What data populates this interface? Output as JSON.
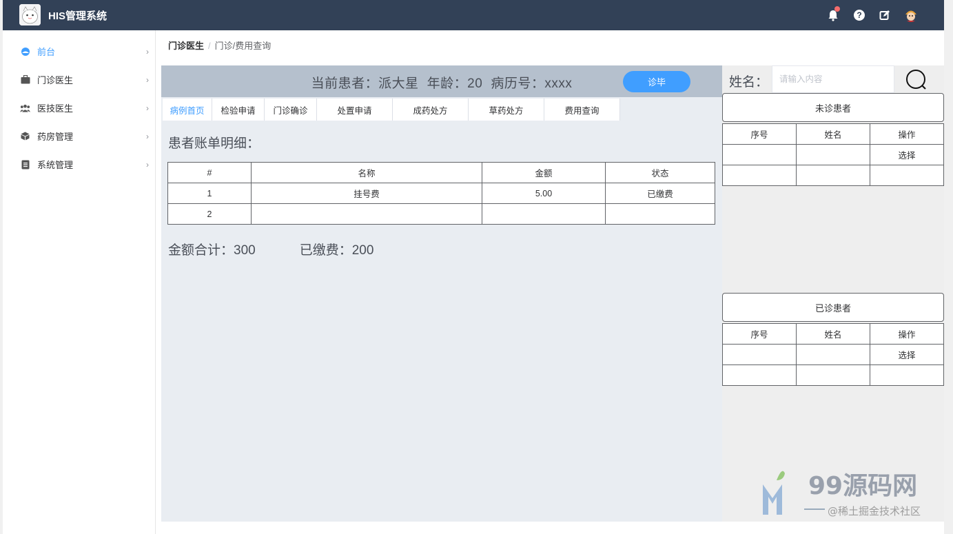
{
  "app": {
    "title": "HIS管理系统"
  },
  "sidebar": {
    "items": [
      {
        "label": "前台",
        "icon": "dashboard-icon",
        "active": true
      },
      {
        "label": "门诊医生",
        "icon": "briefcase-icon"
      },
      {
        "label": "医技医生",
        "icon": "group-icon"
      },
      {
        "label": "药房管理",
        "icon": "box-icon"
      },
      {
        "label": "系统管理",
        "icon": "document-icon"
      }
    ]
  },
  "breadcrumb": {
    "parent": "门诊医生",
    "separator": "/",
    "current": "门诊/费用查询"
  },
  "patient": {
    "label_patient": "当前患者：派大星",
    "label_age": "年龄：20",
    "label_record": "病历号：xxxx",
    "finish_button": "诊毕"
  },
  "tabs": [
    {
      "label": "病例首页",
      "active": true
    },
    {
      "label": "检验申请"
    },
    {
      "label": "门诊确诊"
    },
    {
      "label": "处置申请"
    },
    {
      "label": "成药处方"
    },
    {
      "label": "草药处方"
    },
    {
      "label": "费用查询"
    }
  ],
  "bill": {
    "title": "患者账单明细：",
    "headers": [
      "#",
      "名称",
      "金额",
      "状态"
    ],
    "rows": [
      [
        "1",
        "挂号费",
        "5.00",
        "已缴费"
      ],
      [
        "2",
        "",
        "",
        ""
      ]
    ],
    "total_label": "金额合计：300",
    "paid_label": "已缴费：200"
  },
  "search": {
    "label": "姓名：",
    "placeholder": "请输入内容"
  },
  "waiting": {
    "title": "未诊患者",
    "headers": [
      "序号",
      "姓名",
      "操作"
    ],
    "rows": [
      [
        "",
        "",
        "选择"
      ],
      [
        "",
        "",
        ""
      ]
    ]
  },
  "done": {
    "title": "已诊患者",
    "headers": [
      "序号",
      "姓名",
      "操作"
    ],
    "rows": [
      [
        "",
        "",
        "选择"
      ],
      [
        "",
        "",
        ""
      ]
    ]
  },
  "watermark": {
    "brand": "99源码网",
    "sub": "@稀土掘金技术社区"
  },
  "colors": {
    "topbar": "#324157",
    "accent": "#409eff",
    "patient_bar": "#b5c0cd",
    "main_bg": "#e9edf2"
  }
}
